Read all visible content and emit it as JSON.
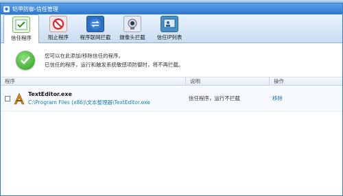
{
  "window": {
    "title": "铠甲防御-信任管理"
  },
  "tabs": [
    {
      "label": "信任程序",
      "active": true,
      "icon": "checklist-icon"
    },
    {
      "label": "阻止程序",
      "active": false,
      "icon": "block-icon"
    },
    {
      "label": "程序联网拦截",
      "active": false,
      "icon": "network-arrows-icon"
    },
    {
      "label": "摄像头拦截",
      "active": false,
      "icon": "webcam-icon"
    },
    {
      "label": "信任IP列表",
      "active": false,
      "icon": "ip-list-icon"
    }
  ],
  "info": {
    "line1": "您可以在此添加/移除信任的程序。",
    "line2": "已信任的程序，运行和触发系统敏感项防御时，将不再拦截。"
  },
  "table": {
    "headers": [
      "程序",
      "说明",
      "操作"
    ],
    "rows": [
      {
        "name": "TextEditor.exe",
        "path": "C:\\Program Files (x86)\\文本整理器\\TextEditor.exe",
        "description": "信任程序，运行不拦截",
        "action": "移除"
      }
    ]
  },
  "colors": {
    "titlebar": "#2d76cf",
    "accent_link": "#1a6fc4",
    "check_green": "#2c9a22"
  }
}
